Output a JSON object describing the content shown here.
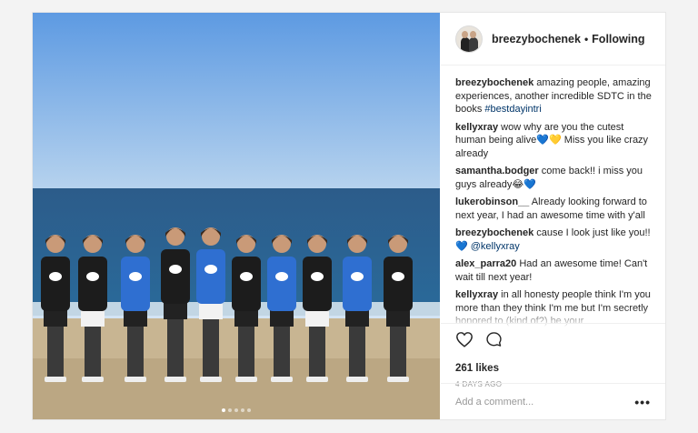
{
  "post": {
    "username": "breezybochenek",
    "separator": "•",
    "follow_status": "Following",
    "likes": "261 likes",
    "date": "4 DAYS AGO",
    "add_comment_placeholder": "Add a comment...",
    "more_icon": "more-horizontal-icon",
    "carousel": {
      "count": 5,
      "active_index": 0
    }
  },
  "comments": [
    {
      "user": "breezybochenek",
      "text": "amazing people, amazing experiences, another incredible SDTC in the books",
      "hashtag": "#bestdayintri"
    },
    {
      "user": "kellyxray",
      "text": "wow why are you the cutest human being alive",
      "emoji": "💙💛",
      "text2": " Miss you like crazy already"
    },
    {
      "user": "samantha.bodger",
      "text": "come back!! i miss you guys already",
      "emoji": "😂💙"
    },
    {
      "user": "lukerobinson__",
      "text": "Already looking forward to next year, I had an awesome time with y'all"
    },
    {
      "user": "breezybochenek",
      "text": "cause I look just like you!!",
      "emoji": "💙",
      "mention": "@kellyxray"
    },
    {
      "user": "alex_parra20",
      "text": "Had an awesome time! Can't wait till next year!"
    },
    {
      "user": "kellyxray",
      "text": "in all honesty people think I'm you more than they think I'm me but I'm secretly honored to (kind of?) be your"
    }
  ],
  "colors": {
    "link": "#003569",
    "sky": "#7fb0e8",
    "ocean": "#2f5f8c",
    "sand": "#c9b896"
  }
}
